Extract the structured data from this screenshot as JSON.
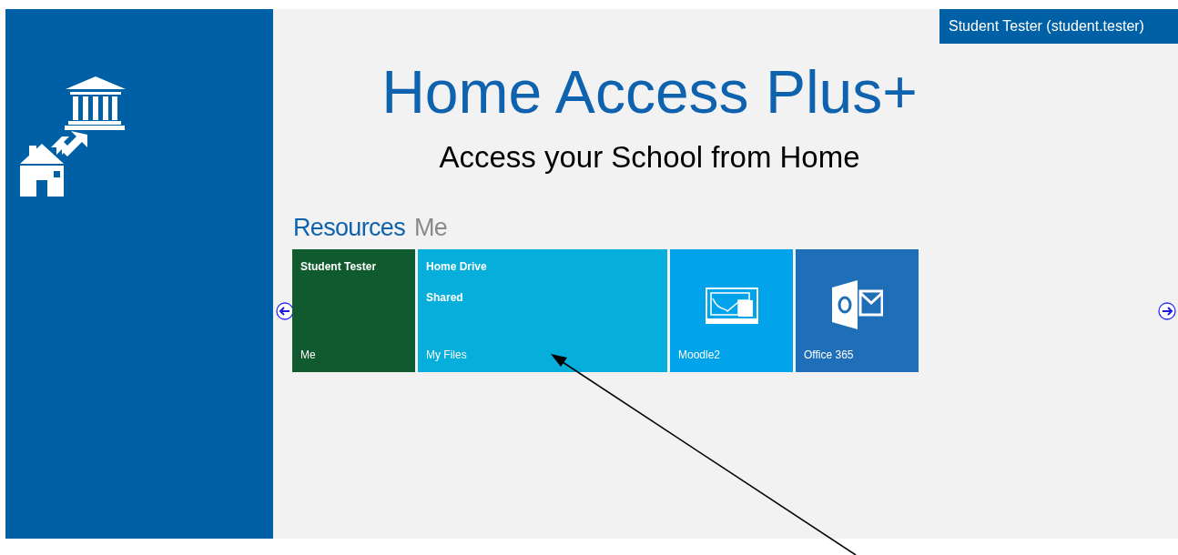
{
  "user_badge": "Student Tester (student.tester)",
  "title": "Home Access Plus+",
  "subtitle": "Access your School from Home",
  "tabs": [
    {
      "label": "Resources",
      "selected": true
    },
    {
      "label": "Me",
      "selected": false
    }
  ],
  "tiles": [
    {
      "kind": "text",
      "top": [
        "Student Tester"
      ],
      "bottom": "Me",
      "color": "#0f5a2e"
    },
    {
      "kind": "text",
      "top": [
        "Home Drive",
        "Shared"
      ],
      "bottom": "My Files",
      "color": "#05aedb"
    },
    {
      "kind": "whiteboard",
      "bottom": "Moodle2",
      "color": "#01a4ea"
    },
    {
      "kind": "mail",
      "bottom": "Office 365",
      "color": "#1e6fb8"
    }
  ]
}
